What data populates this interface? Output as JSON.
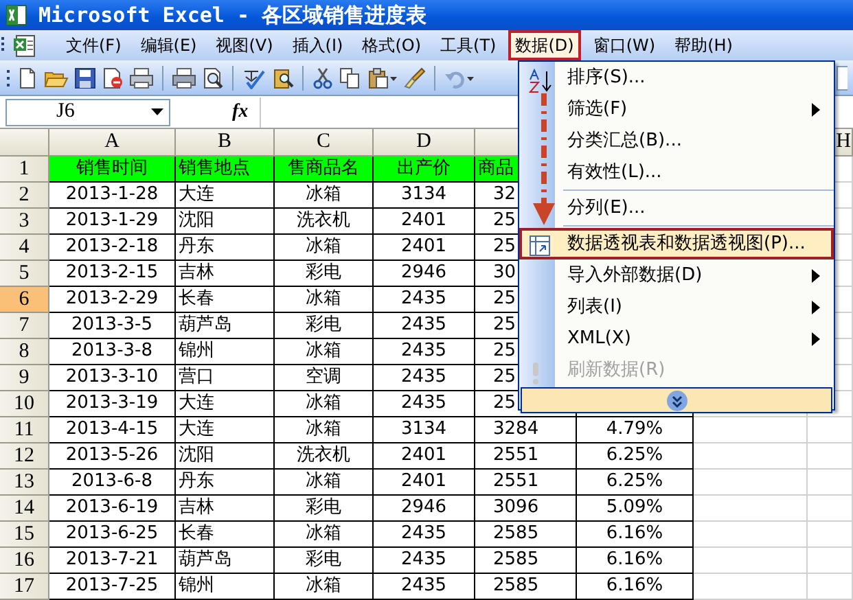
{
  "window": {
    "title": "Microsoft Excel - 各区域销售进度表"
  },
  "menu_bar": [
    {
      "label": "文件(F)",
      "open": false
    },
    {
      "label": "编辑(E)",
      "open": false
    },
    {
      "label": "视图(V)",
      "open": false
    },
    {
      "label": "插入(I)",
      "open": false
    },
    {
      "label": "格式(O)",
      "open": false
    },
    {
      "label": "工具(T)",
      "open": false
    },
    {
      "label": "数据(D)",
      "open": true
    },
    {
      "label": "窗口(W)",
      "open": false
    },
    {
      "label": "帮助(H)",
      "open": false
    }
  ],
  "formula_bar": {
    "name_box": "J6",
    "formula_label": "fx"
  },
  "column_headers": [
    "A",
    "B",
    "C",
    "D",
    "H"
  ],
  "rows": [
    {
      "number": "1",
      "kind": "header",
      "selected": false,
      "cells": [
        "销售时间",
        "销售地点",
        "售商品名",
        "出产价",
        "商品"
      ]
    },
    {
      "number": "2",
      "kind": "data",
      "selected": false,
      "cells": [
        "2013-1-28",
        "大连",
        "冰箱",
        "3134",
        "32"
      ]
    },
    {
      "number": "3",
      "kind": "data",
      "selected": false,
      "cells": [
        "2013-1-29",
        "沈阳",
        "洗衣机",
        "2401",
        "25"
      ]
    },
    {
      "number": "4",
      "kind": "data",
      "selected": false,
      "cells": [
        "2013-2-18",
        "丹东",
        "冰箱",
        "2401",
        "25"
      ]
    },
    {
      "number": "5",
      "kind": "data",
      "selected": false,
      "cells": [
        "2013-2-15",
        "吉林",
        "彩电",
        "2946",
        "30"
      ]
    },
    {
      "number": "6",
      "kind": "data",
      "selected": true,
      "cells": [
        "2013-2-29",
        "长春",
        "冰箱",
        "2435",
        "25"
      ]
    },
    {
      "number": "7",
      "kind": "data",
      "selected": false,
      "cells": [
        "2013-3-5",
        "葫芦岛",
        "彩电",
        "2435",
        "25"
      ]
    },
    {
      "number": "8",
      "kind": "data",
      "selected": false,
      "cells": [
        "2013-3-8",
        "锦州",
        "冰箱",
        "2435",
        "25"
      ]
    },
    {
      "number": "9",
      "kind": "data",
      "selected": false,
      "cells": [
        "2013-3-10",
        "营口",
        "空调",
        "2435",
        "25"
      ]
    },
    {
      "number": "10",
      "kind": "data",
      "selected": false,
      "cells": [
        "2013-3-19",
        "大连",
        "冰箱",
        "2435",
        "25"
      ]
    },
    {
      "number": "11",
      "kind": "data",
      "selected": false,
      "cells": [
        "2013-4-15",
        "大连",
        "冰箱",
        "3134",
        "3284",
        "4.79%"
      ]
    },
    {
      "number": "12",
      "kind": "data",
      "selected": false,
      "cells": [
        "2013-5-26",
        "沈阳",
        "洗衣机",
        "2401",
        "2551",
        "6.25%"
      ]
    },
    {
      "number": "13",
      "kind": "data",
      "selected": false,
      "cells": [
        "2013-6-8",
        "丹东",
        "冰箱",
        "2401",
        "2551",
        "6.25%"
      ]
    },
    {
      "number": "14",
      "kind": "data",
      "selected": false,
      "cells": [
        "2013-6-19",
        "吉林",
        "彩电",
        "2946",
        "3096",
        "5.09%"
      ]
    },
    {
      "number": "15",
      "kind": "data",
      "selected": false,
      "cells": [
        "2013-6-25",
        "长春",
        "冰箱",
        "2435",
        "2585",
        "6.16%"
      ]
    },
    {
      "number": "16",
      "kind": "data",
      "selected": false,
      "cells": [
        "2013-7-21",
        "葫芦岛",
        "彩电",
        "2435",
        "2585",
        "6.16%"
      ]
    },
    {
      "number": "17",
      "kind": "data",
      "selected": false,
      "cells": [
        "2013-7-25",
        "锦州",
        "冰箱",
        "2435",
        "2585",
        "6.16%"
      ]
    }
  ],
  "dropdown": {
    "items": [
      {
        "kind": "item",
        "label": "排序(S)...",
        "submenu": false,
        "highlighted": false,
        "disabled": false
      },
      {
        "kind": "item",
        "label": "筛选(F)",
        "submenu": true,
        "highlighted": false,
        "disabled": false
      },
      {
        "kind": "item",
        "label": "分类汇总(B)...",
        "submenu": false,
        "highlighted": false,
        "disabled": false
      },
      {
        "kind": "item",
        "label": "有效性(L)...",
        "submenu": false,
        "highlighted": false,
        "disabled": false
      },
      {
        "kind": "separator"
      },
      {
        "kind": "item",
        "label": "分列(E)...",
        "submenu": false,
        "highlighted": false,
        "disabled": false
      },
      {
        "kind": "separator"
      },
      {
        "kind": "item",
        "label": "数据透视表和数据透视图(P)...",
        "submenu": false,
        "highlighted": true,
        "disabled": false
      },
      {
        "kind": "item",
        "label": "导入外部数据(D)",
        "submenu": true,
        "highlighted": false,
        "disabled": false
      },
      {
        "kind": "item",
        "label": "列表(I)",
        "submenu": true,
        "highlighted": false,
        "disabled": false
      },
      {
        "kind": "item",
        "label": "XML(X)",
        "submenu": true,
        "highlighted": false,
        "disabled": false
      },
      {
        "kind": "item",
        "label": "刷新数据(R)",
        "submenu": false,
        "highlighted": false,
        "disabled": true
      },
      {
        "kind": "expand"
      }
    ]
  }
}
